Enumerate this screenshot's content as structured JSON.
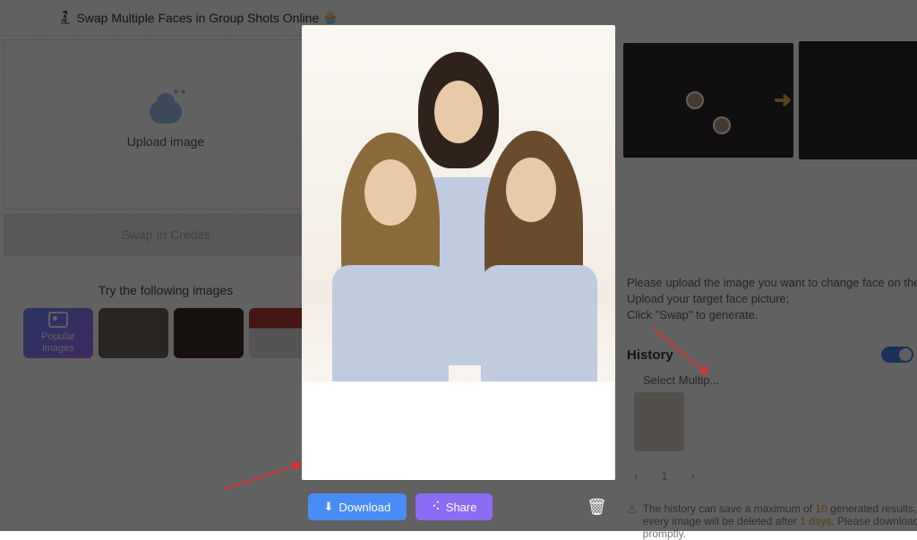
{
  "top": {
    "emoji_left": "🧎🏻‍♀️",
    "title": "Swap Multiple Faces in Group Shots Online",
    "emoji_right": "🧁"
  },
  "upload": {
    "label": "Upload image"
  },
  "swap_button": {
    "label": "Swap In Credits"
  },
  "try": {
    "label": "Try the following images",
    "popular_label": "Popular\nimages"
  },
  "steps": {
    "s1": "Please upload the image you want to change face on the left side;",
    "s2": "Upload your target face picture;",
    "s3": "Click \"Swap\" to generate."
  },
  "history": {
    "title": "History",
    "select_label": "Select Multip..."
  },
  "pager": {
    "prev": "‹",
    "page": "1",
    "next": "›"
  },
  "notice": {
    "pre": "The history can save a maximum of",
    "max": "10",
    "mid": "generated results, and every image will be deleted after",
    "days": "1 days",
    "post": ". Please download promptly."
  },
  "modal": {
    "download": "Download",
    "share": "Share"
  }
}
